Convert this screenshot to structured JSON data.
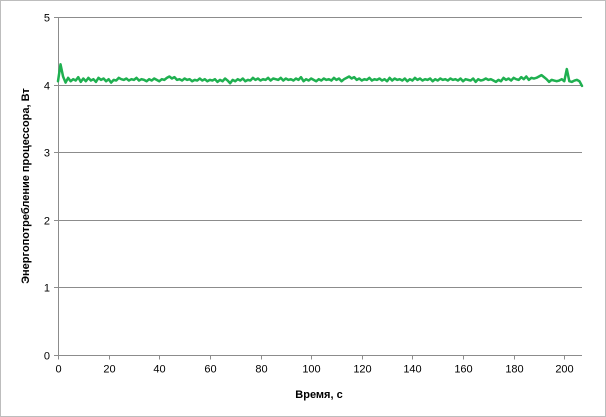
{
  "chart_data": {
    "type": "line",
    "title": "",
    "xlabel": "Время, с",
    "ylabel": "Энергопотребление процессора, Вт",
    "xlim": [
      0,
      207
    ],
    "ylim": [
      0,
      5
    ],
    "x_ticks": [
      0,
      20,
      40,
      60,
      80,
      100,
      120,
      140,
      160,
      180,
      200
    ],
    "y_ticks": [
      0,
      1,
      2,
      3,
      4,
      5
    ],
    "x_tick_labels": [
      "0",
      "20",
      "40",
      "60",
      "80",
      "100",
      "120",
      "140",
      "160",
      "180",
      "200"
    ],
    "y_tick_labels": [
      "0",
      "1",
      "2",
      "3",
      "4",
      "5"
    ],
    "grid": "horizontal",
    "legend": "none",
    "series": [
      {
        "color": "#1fb050",
        "x": [
          0,
          1,
          2,
          3,
          4,
          5,
          6,
          7,
          8,
          9,
          10,
          11,
          12,
          13,
          14,
          15,
          16,
          17,
          18,
          19,
          20,
          21,
          22,
          23,
          24,
          25,
          26,
          27,
          28,
          29,
          30,
          31,
          32,
          33,
          34,
          35,
          36,
          37,
          38,
          39,
          40,
          41,
          42,
          43,
          44,
          45,
          46,
          47,
          48,
          49,
          50,
          51,
          52,
          53,
          54,
          55,
          56,
          57,
          58,
          59,
          60,
          61,
          62,
          63,
          64,
          65,
          66,
          67,
          68,
          69,
          70,
          71,
          72,
          73,
          74,
          75,
          76,
          77,
          78,
          79,
          80,
          81,
          82,
          83,
          84,
          85,
          86,
          87,
          88,
          89,
          90,
          91,
          92,
          93,
          94,
          95,
          96,
          97,
          98,
          99,
          100,
          101,
          102,
          103,
          104,
          105,
          106,
          107,
          108,
          109,
          110,
          111,
          112,
          113,
          114,
          115,
          116,
          117,
          118,
          119,
          120,
          121,
          122,
          123,
          124,
          125,
          126,
          127,
          128,
          129,
          130,
          131,
          132,
          133,
          134,
          135,
          136,
          137,
          138,
          139,
          140,
          141,
          142,
          143,
          144,
          145,
          146,
          147,
          148,
          149,
          150,
          151,
          152,
          153,
          154,
          155,
          156,
          157,
          158,
          159,
          160,
          161,
          162,
          163,
          164,
          165,
          166,
          167,
          168,
          169,
          170,
          171,
          172,
          173,
          174,
          175,
          176,
          177,
          178,
          179,
          180,
          181,
          182,
          183,
          184,
          185,
          186,
          187,
          188,
          189,
          190,
          191,
          192,
          193,
          194,
          195,
          196,
          197,
          198,
          199,
          200,
          201,
          202,
          203,
          204,
          205,
          206,
          207
        ],
        "y": [
          4.05,
          4.3,
          4.12,
          4.03,
          4.1,
          4.05,
          4.08,
          4.06,
          4.11,
          4.04,
          4.09,
          4.05,
          4.1,
          4.06,
          4.08,
          4.04,
          4.1,
          4.07,
          4.09,
          4.05,
          4.08,
          4.03,
          4.07,
          4.06,
          4.1,
          4.08,
          4.07,
          4.09,
          4.06,
          4.08,
          4.07,
          4.1,
          4.06,
          4.08,
          4.07,
          4.05,
          4.08,
          4.06,
          4.09,
          4.07,
          4.05,
          4.08,
          4.07,
          4.1,
          4.12,
          4.09,
          4.11,
          4.07,
          4.08,
          4.06,
          4.09,
          4.07,
          4.08,
          4.05,
          4.07,
          4.06,
          4.09,
          4.06,
          4.08,
          4.05,
          4.07,
          4.06,
          4.08,
          4.04,
          4.07,
          4.05,
          4.09,
          4.06,
          4.02,
          4.07,
          4.05,
          4.08,
          4.06,
          4.09,
          4.05,
          4.07,
          4.06,
          4.1,
          4.07,
          4.09,
          4.06,
          4.08,
          4.07,
          4.1,
          4.06,
          4.09,
          4.08,
          4.07,
          4.1,
          4.06,
          4.09,
          4.07,
          4.08,
          4.06,
          4.09,
          4.07,
          4.11,
          4.05,
          4.08,
          4.06,
          4.09,
          4.07,
          4.05,
          4.08,
          4.06,
          4.09,
          4.07,
          4.08,
          4.06,
          4.1,
          4.07,
          4.09,
          4.05,
          4.08,
          4.1,
          4.12,
          4.09,
          4.11,
          4.07,
          4.09,
          4.06,
          4.08,
          4.07,
          4.1,
          4.06,
          4.08,
          4.07,
          4.09,
          4.06,
          4.08,
          4.05,
          4.1,
          4.06,
          4.09,
          4.07,
          4.08,
          4.06,
          4.09,
          4.05,
          4.08,
          4.06,
          4.1,
          4.07,
          4.09,
          4.06,
          4.08,
          4.07,
          4.09,
          4.05,
          4.08,
          4.06,
          4.09,
          4.07,
          4.08,
          4.06,
          4.09,
          4.07,
          4.08,
          4.06,
          4.09,
          4.05,
          4.08,
          4.07,
          4.06,
          4.09,
          4.04,
          4.08,
          4.06,
          4.07,
          4.09,
          4.07,
          4.08,
          4.06,
          4.04,
          4.07,
          4.05,
          4.1,
          4.07,
          4.09,
          4.06,
          4.1,
          4.08,
          4.07,
          4.11,
          4.08,
          4.12,
          4.07,
          4.1,
          4.09,
          4.1,
          4.12,
          4.14,
          4.11,
          4.08,
          4.04,
          4.07,
          4.06,
          4.05,
          4.06,
          4.08,
          4.05,
          4.23,
          4.05,
          4.04,
          4.06,
          4.07,
          4.05,
          3.98
        ]
      }
    ]
  }
}
